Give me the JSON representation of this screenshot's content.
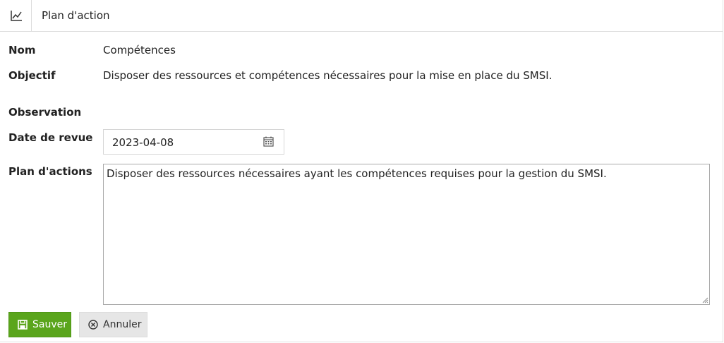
{
  "header": {
    "icon": "chart-line-icon",
    "title": "Plan d'action"
  },
  "form": {
    "nom": {
      "label": "Nom",
      "value": "Compétences"
    },
    "objectif": {
      "label": "Objectif",
      "value": "Disposer des ressources et compétences nécessaires  pour la mise en place du SMSI."
    },
    "observation": {
      "label": "Observation",
      "value": ""
    },
    "date_revue": {
      "label": "Date de revue",
      "value": "2023-04-08",
      "icon": "calendar-icon"
    },
    "plan_actions": {
      "label": "Plan d'actions",
      "value": "Disposer des ressources nécessaires ayant les compétences requises pour la gestion du SMSI."
    }
  },
  "actions": {
    "save": {
      "label": "Sauver",
      "icon": "save-icon",
      "color": "#5aa51c"
    },
    "cancel": {
      "label": "Annuler",
      "icon": "cancel-circle-icon",
      "color": "#e6e6e6"
    }
  }
}
